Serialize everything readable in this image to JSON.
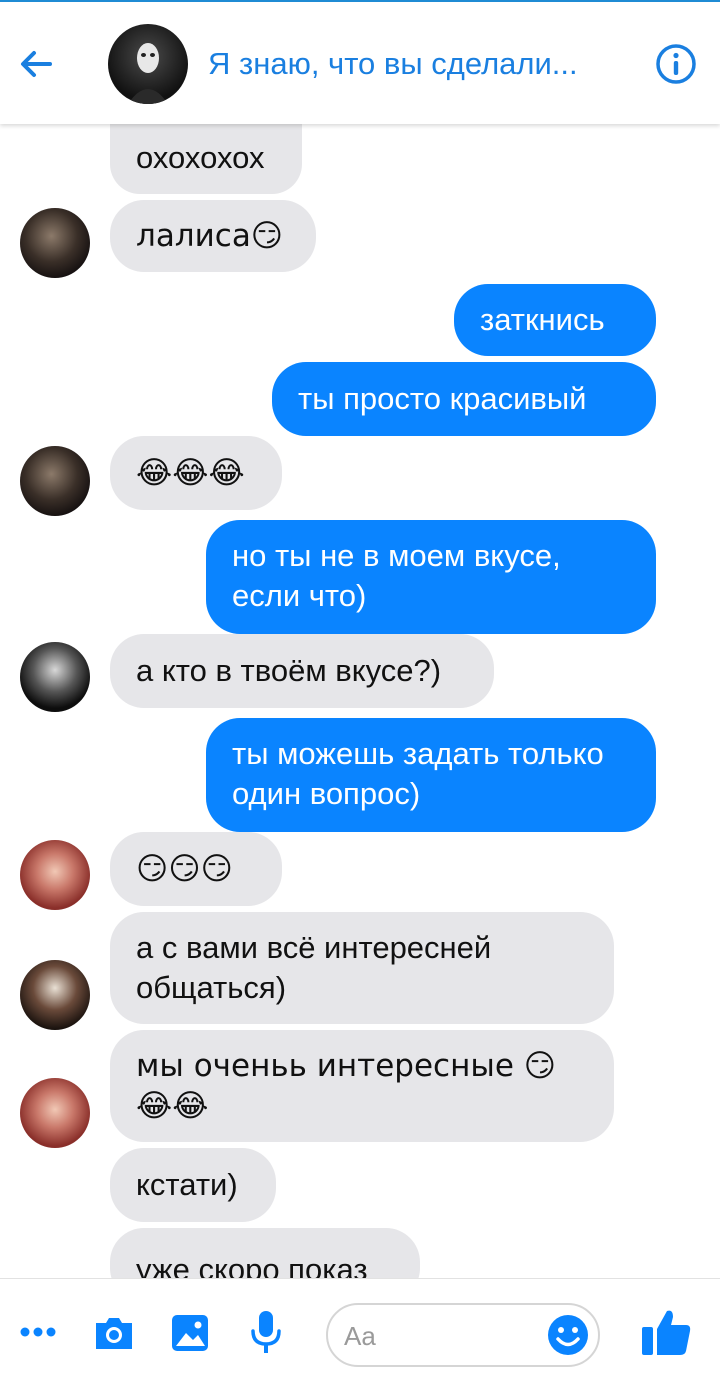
{
  "header": {
    "title": "Я знаю, что вы сделали...",
    "back_icon": "back-arrow-icon",
    "info_icon": "info-icon",
    "accent_color": "#1a7fe0"
  },
  "messages": [
    {
      "side": "in",
      "text": "охохохох"
    },
    {
      "side": "in",
      "text": "лалиса😏"
    },
    {
      "side": "out",
      "text": "заткнись"
    },
    {
      "side": "out",
      "text": "ты просто красивый"
    },
    {
      "side": "in",
      "text": "😂😂😂"
    },
    {
      "side": "out",
      "text": "но ты не в моем вкусе, если что)"
    },
    {
      "side": "in",
      "text": "а кто в твоём вкусе?)"
    },
    {
      "side": "out",
      "text": "ты можешь задать только один вопрос)"
    },
    {
      "side": "in",
      "text": "😏😏😏"
    },
    {
      "side": "in",
      "text": "а с вами всё интересней общаться)"
    },
    {
      "side": "in",
      "text": "мы оченьь интересные 😏😂😂"
    },
    {
      "side": "in",
      "text": "кстати)"
    },
    {
      "side": "in",
      "text": "уже скоро показ"
    }
  ],
  "composer": {
    "placeholder": "Aa",
    "icons": [
      "more-icon",
      "camera-icon",
      "image-icon",
      "microphone-icon",
      "emoji-icon",
      "thumbs-up-icon"
    ]
  },
  "colors": {
    "outgoing_bubble": "#0a84ff",
    "incoming_bubble": "#e6e6e9",
    "icon_blue": "#0a84ff"
  }
}
